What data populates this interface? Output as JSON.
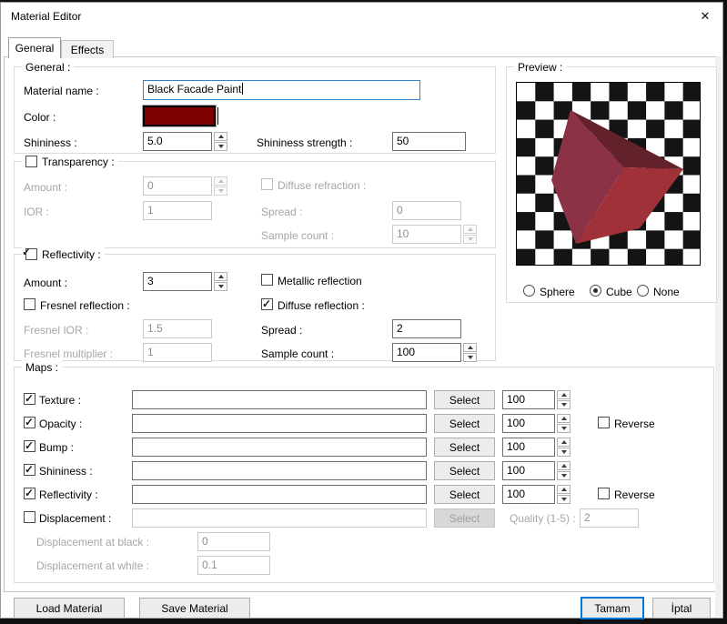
{
  "window": {
    "title": "Material Editor",
    "close_icon": "✕"
  },
  "tabs": [
    {
      "label": "General",
      "active": true
    },
    {
      "label": "Effects",
      "active": false
    }
  ],
  "general": {
    "legend": "General :",
    "material_name_label": "Material name :",
    "material_name_value": "Black Facade Paint",
    "color_label": "Color :",
    "color_value": "#7d0101",
    "shininess_label": "Shininess :",
    "shininess_value": "5.0",
    "shininess_strength_label": "Shininess strength :",
    "shininess_strength_value": "50"
  },
  "transparency": {
    "legend": "Transparency :",
    "checked": false,
    "amount_label": "Amount :",
    "amount_value": "0",
    "ior_label": "IOR :",
    "ior_value": "1",
    "diffuse_refraction_label": "Diffuse refraction :",
    "spread_label": "Spread :",
    "spread_value": "0",
    "sample_count_label": "Sample count :",
    "sample_count_value": "10"
  },
  "reflectivity": {
    "legend": "Reflectivity :",
    "checked": true,
    "amount_label": "Amount :",
    "amount_value": "3",
    "metallic_label": "Metallic reflection",
    "metallic_checked": false,
    "fresnel_label": "Fresnel reflection :",
    "fresnel_checked": false,
    "diffuse_label": "Diffuse reflection :",
    "diffuse_checked": true,
    "fresnel_ior_label": "Fresnel IOR :",
    "fresnel_ior_value": "1.5",
    "spread_label": "Spread :",
    "spread_value": "2",
    "fresnel_multiplier_label": "Fresnel multiplier :",
    "fresnel_multiplier_value": "1",
    "sample_count_label": "Sample count :",
    "sample_count_value": "100"
  },
  "maps": {
    "legend": "Maps :",
    "select_label": "Select",
    "reverse_label": "Reverse",
    "rows": [
      {
        "label": "Texture :",
        "checked": true,
        "path": "",
        "amount": "100",
        "reverse": false
      },
      {
        "label": "Opacity :",
        "checked": true,
        "path": "",
        "amount": "100",
        "reverse": false
      },
      {
        "label": "Bump :",
        "checked": true,
        "path": "",
        "amount": "100",
        "reverse": false
      },
      {
        "label": "Shininess :",
        "checked": true,
        "path": "",
        "amount": "100",
        "reverse": false
      },
      {
        "label": "Reflectivity :",
        "checked": true,
        "path": "",
        "amount": "100",
        "reverse": false
      },
      {
        "label": "Displacement :",
        "checked": false,
        "path": "",
        "disabled": true
      }
    ],
    "quality_label": "Quality (1-5) :",
    "quality_value": "2",
    "displacement_black_label": "Displacement at black :",
    "displacement_black_value": "0",
    "displacement_white_label": "Displacement at white :",
    "displacement_white_value": "0.1"
  },
  "preview": {
    "legend": "Preview :",
    "options": [
      {
        "label": "Sphere",
        "selected": false
      },
      {
        "label": "Cube",
        "selected": true
      },
      {
        "label": "None",
        "selected": false
      }
    ],
    "cube_colors": {
      "left": "#8c3247",
      "top": "#63212b",
      "right": "#a03139"
    },
    "checker_dark": "#141414"
  },
  "footer": {
    "load_label": "Load Material",
    "save_label": "Save Material",
    "ok_label": "Tamam",
    "cancel_label": "İptal"
  },
  "colors": {
    "focus_border": "#2f83cc",
    "default_button_border": "#0078d7",
    "swatch": "#7d0101"
  }
}
